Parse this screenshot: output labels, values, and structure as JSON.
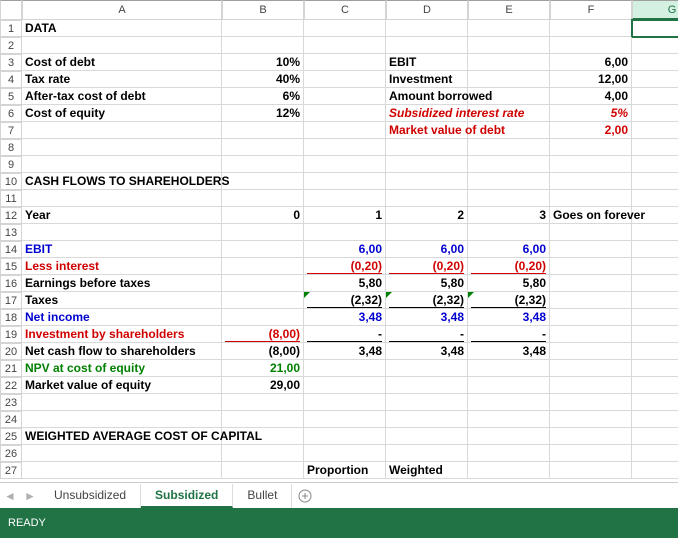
{
  "columns": [
    "A",
    "B",
    "C",
    "D",
    "E",
    "F",
    "G"
  ],
  "selected_col": "G",
  "rows": {
    "1": {
      "A": {
        "t": "DATA",
        "cls": "bold"
      }
    },
    "2": {},
    "3": {
      "A": {
        "t": "Cost of debt",
        "cls": "bold"
      },
      "B": {
        "t": "10%",
        "cls": "bold r"
      },
      "D": {
        "t": "EBIT",
        "cls": "bold"
      },
      "F": {
        "t": "6,00",
        "cls": "bold r"
      }
    },
    "4": {
      "A": {
        "t": "Tax rate",
        "cls": "bold"
      },
      "B": {
        "t": "40%",
        "cls": "bold r"
      },
      "D": {
        "t": "Investment",
        "cls": "bold"
      },
      "F": {
        "t": "12,00",
        "cls": "bold r"
      }
    },
    "5": {
      "A": {
        "t": "After-tax cost of debt",
        "cls": "bold"
      },
      "B": {
        "t": "6%",
        "cls": "bold r"
      },
      "D": {
        "t": "Amount borrowed",
        "cls": "bold"
      },
      "F": {
        "t": "4,00",
        "cls": "bold r"
      }
    },
    "6": {
      "A": {
        "t": "Cost of equity",
        "cls": "bold"
      },
      "B": {
        "t": "12%",
        "cls": "bold r"
      },
      "D": {
        "t": "Subsidized interest rate",
        "cls": "bold red italic"
      },
      "F": {
        "t": "5%",
        "cls": "bold red italic r"
      }
    },
    "7": {
      "D": {
        "t": "Market value of debt",
        "cls": "bold red"
      },
      "F": {
        "t": "2,00",
        "cls": "bold red r"
      }
    },
    "8": {},
    "9": {},
    "10": {
      "A": {
        "t": "CASH FLOWS TO SHAREHOLDERS",
        "cls": "bold"
      }
    },
    "11": {},
    "12": {
      "A": {
        "t": "Year",
        "cls": "bold"
      },
      "B": {
        "t": "0",
        "cls": "bold r"
      },
      "C": {
        "t": "1",
        "cls": "bold r"
      },
      "D": {
        "t": "2",
        "cls": "bold r"
      },
      "E": {
        "t": "3",
        "cls": "bold r"
      },
      "F": {
        "t": "Goes on forever",
        "cls": "bold"
      }
    },
    "13": {},
    "14": {
      "A": {
        "t": "EBIT",
        "cls": "bold blue"
      },
      "C": {
        "t": "6,00",
        "cls": "bold blue r"
      },
      "D": {
        "t": "6,00",
        "cls": "bold blue r"
      },
      "E": {
        "t": "6,00",
        "cls": "bold blue r"
      }
    },
    "15": {
      "A": {
        "t": "Less interest",
        "cls": "bold red"
      },
      "C": {
        "t": "(0,20)",
        "cls": "bold red r ur"
      },
      "D": {
        "t": "(0,20)",
        "cls": "bold red r ur"
      },
      "E": {
        "t": "(0,20)",
        "cls": "bold red r ur"
      }
    },
    "16": {
      "A": {
        "t": "Earnings before taxes",
        "cls": "bold"
      },
      "C": {
        "t": "5,80",
        "cls": "bold r"
      },
      "D": {
        "t": "5,80",
        "cls": "bold r"
      },
      "E": {
        "t": "5,80",
        "cls": "bold r"
      }
    },
    "17": {
      "A": {
        "t": "Taxes",
        "cls": "bold"
      },
      "C": {
        "t": "(2,32)",
        "cls": "bold r ub tri"
      },
      "D": {
        "t": "(2,32)",
        "cls": "bold r ub tri"
      },
      "E": {
        "t": "(2,32)",
        "cls": "bold r ub tri"
      }
    },
    "18": {
      "A": {
        "t": "Net income",
        "cls": "bold blue"
      },
      "C": {
        "t": "3,48",
        "cls": "bold blue r"
      },
      "D": {
        "t": "3,48",
        "cls": "bold blue r"
      },
      "E": {
        "t": "3,48",
        "cls": "bold blue r"
      }
    },
    "19": {
      "A": {
        "t": "Investment by shareholders",
        "cls": "bold red"
      },
      "B": {
        "t": "(8,00)",
        "cls": "bold red r ur"
      },
      "C": {
        "t": "-",
        "cls": "bold r ub"
      },
      "D": {
        "t": "-",
        "cls": "bold r ub"
      },
      "E": {
        "t": "-",
        "cls": "bold r ub"
      }
    },
    "20": {
      "A": {
        "t": "Net cash flow to shareholders",
        "cls": "bold"
      },
      "B": {
        "t": "(8,00)",
        "cls": "bold r"
      },
      "C": {
        "t": "3,48",
        "cls": "bold r"
      },
      "D": {
        "t": "3,48",
        "cls": "bold r"
      },
      "E": {
        "t": "3,48",
        "cls": "bold r"
      }
    },
    "21": {
      "A": {
        "t": "NPV at cost of equity",
        "cls": "bold green"
      },
      "B": {
        "t": "21,00",
        "cls": "bold green r"
      }
    },
    "22": {
      "A": {
        "t": "Market value of equity",
        "cls": "bold"
      },
      "B": {
        "t": "29,00",
        "cls": "bold r"
      }
    },
    "23": {},
    "24": {},
    "25": {
      "A": {
        "t": "WEIGHTED AVERAGE COST OF CAPITAL",
        "cls": "bold"
      }
    },
    "26": {},
    "27": {
      "C": {
        "t": "Proportion",
        "cls": "bold"
      },
      "D": {
        "t": "Weighted",
        "cls": "bold"
      }
    }
  },
  "row_count": 27,
  "tabs": {
    "items": [
      "Unsubsidized",
      "Subsidized",
      "Bullet"
    ],
    "active": 1
  },
  "status": "READY",
  "chart_data": {
    "type": "table",
    "title": "Subsidized debt financing analysis",
    "assumptions": {
      "cost_of_debt": 0.1,
      "tax_rate": 0.4,
      "after_tax_cost_of_debt": 0.06,
      "cost_of_equity": 0.12,
      "EBIT": 6.0,
      "investment": 12.0,
      "amount_borrowed": 4.0,
      "subsidized_interest_rate": 0.05,
      "market_value_of_debt": 2.0
    },
    "cash_flows_to_shareholders": {
      "years": [
        0,
        1,
        2,
        3
      ],
      "perpetuity_note": "Goes on forever",
      "series": [
        {
          "name": "EBIT",
          "values": [
            null,
            6.0,
            6.0,
            6.0
          ]
        },
        {
          "name": "Less interest",
          "values": [
            null,
            -0.2,
            -0.2,
            -0.2
          ]
        },
        {
          "name": "Earnings before taxes",
          "values": [
            null,
            5.8,
            5.8,
            5.8
          ]
        },
        {
          "name": "Taxes",
          "values": [
            null,
            -2.32,
            -2.32,
            -2.32
          ]
        },
        {
          "name": "Net income",
          "values": [
            null,
            3.48,
            3.48,
            3.48
          ]
        },
        {
          "name": "Investment by shareholders",
          "values": [
            -8.0,
            0,
            0,
            0
          ]
        },
        {
          "name": "Net cash flow to shareholders",
          "values": [
            -8.0,
            3.48,
            3.48,
            3.48
          ]
        }
      ],
      "NPV_at_cost_of_equity": 21.0,
      "market_value_of_equity": 29.0
    },
    "wacc_table_headers": [
      "Proportion",
      "Weighted"
    ]
  }
}
